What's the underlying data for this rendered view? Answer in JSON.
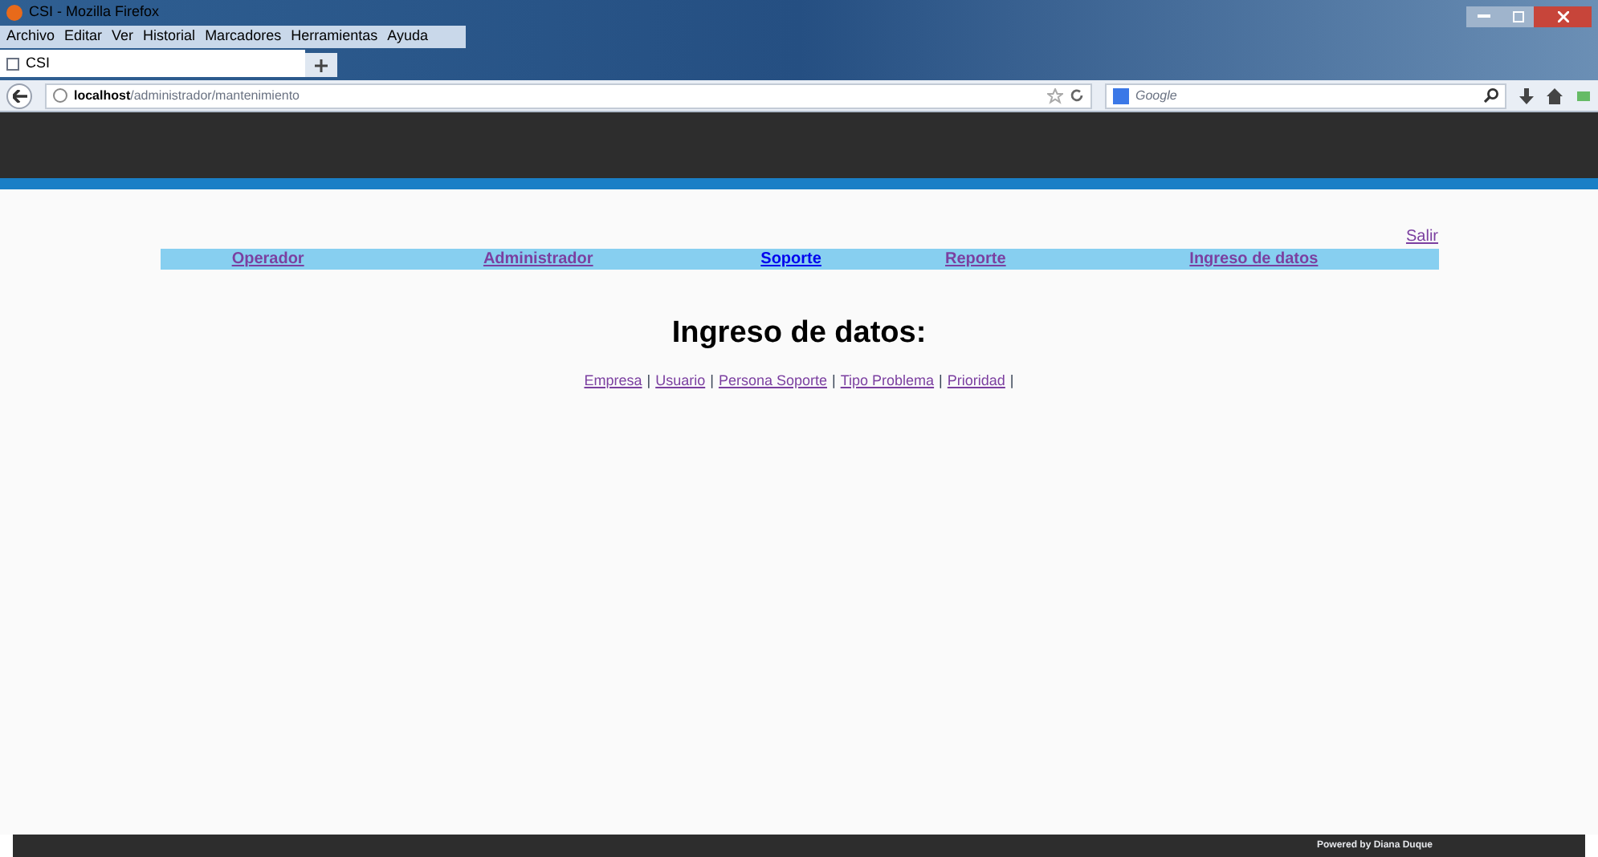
{
  "window": {
    "title": "CSI - Mozilla Firefox"
  },
  "menu": [
    "Archivo",
    "Editar",
    "Ver",
    "Historial",
    "Marcadores",
    "Herramientas",
    "Ayuda"
  ],
  "tabs": [
    {
      "label": "CSI",
      "selected": true
    }
  ],
  "address": {
    "host": "localhost",
    "path": "/administrador/mantenimiento"
  },
  "search": {
    "placeholder": "Google"
  },
  "logout": {
    "label": "Salir",
    "visited": true
  },
  "nav": [
    {
      "label": "Operador",
      "visited": true
    },
    {
      "label": "Administrador",
      "visited": true
    },
    {
      "label": "Soporte",
      "visited": false
    },
    {
      "label": "Reporte",
      "visited": true
    },
    {
      "label": "Ingreso de datos",
      "visited": true
    }
  ],
  "heading": "Ingreso de datos:",
  "links": [
    {
      "label": "Empresa",
      "visited": true
    },
    {
      "label": "Usuario",
      "visited": true
    },
    {
      "label": "Persona Soporte",
      "visited": true
    },
    {
      "label": "Tipo Problema",
      "visited": true
    },
    {
      "label": "Prioridad",
      "visited": true
    }
  ],
  "separator": "|",
  "footer": "Powered by Diana Duque"
}
